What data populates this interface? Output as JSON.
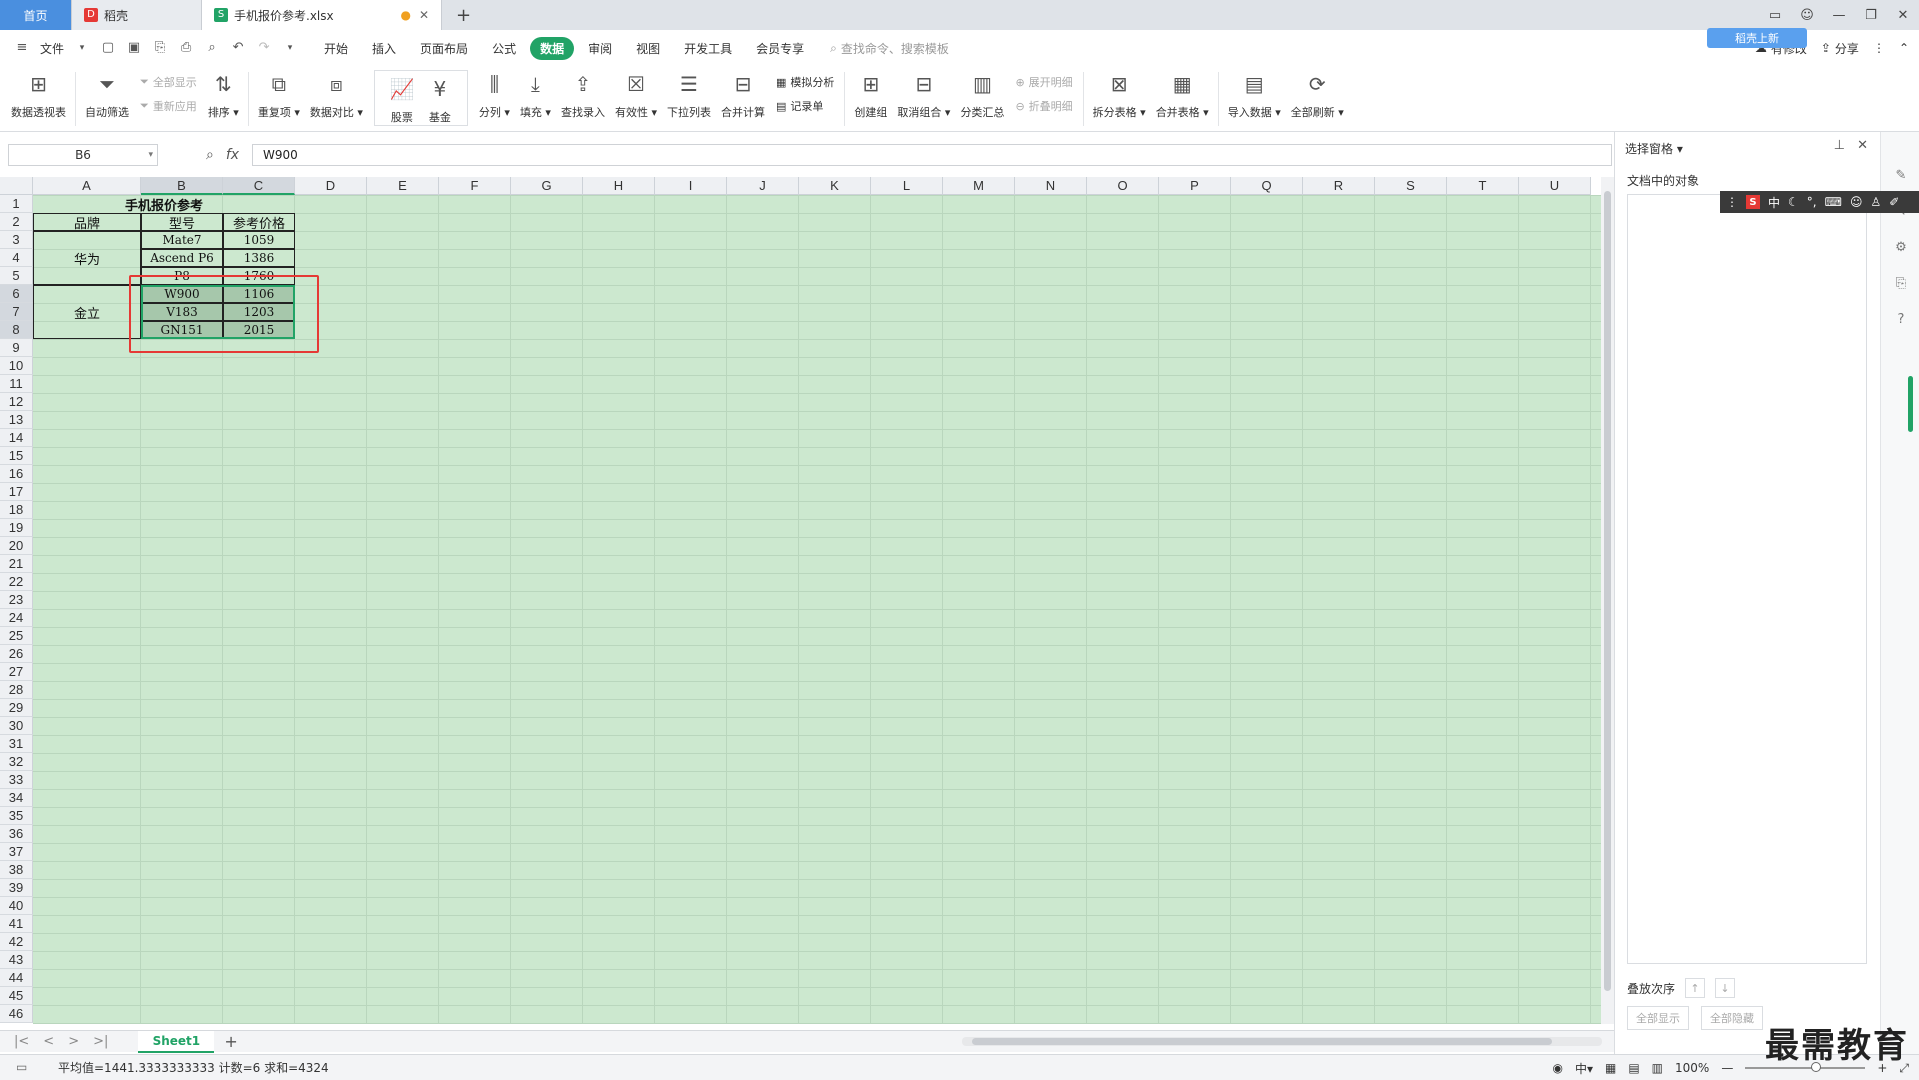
{
  "titlebar": {
    "tabs": [
      {
        "label": "首页"
      },
      {
        "label": "稻壳"
      },
      {
        "label": "手机报价参考.xlsx"
      }
    ],
    "add_tab": "+",
    "window_controls": {
      "minimize": "—",
      "restore": "❐",
      "close": "✕"
    }
  },
  "menubar": {
    "file_menu": "文件",
    "tabs": [
      "开始",
      "插入",
      "页面布局",
      "公式",
      "数据",
      "审阅",
      "视图",
      "开发工具",
      "会员专享"
    ],
    "active_tab": "数据",
    "search_placeholder": "查找命令、搜索模板",
    "right": {
      "unsynced": "有修改",
      "share": "分享"
    },
    "login_badge": "稻壳上新"
  },
  "ribbon": {
    "pivot": "数据透视表",
    "autofilter": "自动筛选",
    "show_all": "全部显示",
    "reapply": "重新应用",
    "sort": "排序",
    "duplicates": "重复项",
    "compare": "数据对比",
    "stock": "股票",
    "fund": "基金",
    "split": "分列",
    "fill": "填充",
    "lookup": "查找录入",
    "validity": "有效性",
    "dropdown": "下拉列表",
    "consolidate": "合并计算",
    "whatif": "模拟分析",
    "record": "记录单",
    "group": "创建组",
    "ungroup": "取消组合",
    "subtotal": "分类汇总",
    "expand": "展开明细",
    "collapse": "折叠明细",
    "split_table": "拆分表格",
    "merge_table": "合并表格",
    "import": "导入数据",
    "refresh_all": "全部刷新"
  },
  "formula_bar": {
    "name_box": "B6",
    "fx": "fx",
    "value": "W900"
  },
  "columns": [
    "A",
    "B",
    "C",
    "D",
    "E",
    "F",
    "G",
    "H",
    "I",
    "J",
    "K",
    "L",
    "M",
    "N",
    "O",
    "P",
    "Q",
    "R",
    "S",
    "T",
    "U"
  ],
  "rows": [
    "1",
    "2",
    "3",
    "4",
    "5",
    "6",
    "7",
    "8",
    "9",
    "10",
    "11",
    "12",
    "13",
    "14",
    "15",
    "16",
    "17",
    "18",
    "19",
    "20",
    "21",
    "22",
    "23",
    "24",
    "25",
    "26",
    "27",
    "28",
    "29",
    "30",
    "31",
    "32",
    "33",
    "34",
    "35",
    "36",
    "37",
    "38",
    "39",
    "40",
    "41",
    "42",
    "43",
    "44",
    "45",
    "46"
  ],
  "sheet": {
    "title": "手机报价参考",
    "headers": {
      "brand": "品牌",
      "model": "型号",
      "price": "参考价格"
    },
    "groups": [
      {
        "brand": "华为",
        "items": [
          {
            "model": "Mate7",
            "price": "1059"
          },
          {
            "model": "Ascend P6",
            "price": "1386"
          },
          {
            "model": "P8",
            "price": "1760"
          }
        ]
      },
      {
        "brand": "金立",
        "items": [
          {
            "model": "W900",
            "price": "1106"
          },
          {
            "model": "V183",
            "price": "1203"
          },
          {
            "model": "GN151",
            "price": "2015"
          }
        ]
      }
    ]
  },
  "sheet_tabs": {
    "active": "Sheet1",
    "add": "+"
  },
  "status": {
    "summary": "平均值=1441.3333333333  计数=6  求和=4324",
    "zoom": "100%"
  },
  "side_pane": {
    "title": "选择窗格",
    "objects_label": "文档中的对象",
    "order_label": "叠放次序",
    "show_all": "全部显示",
    "hide_all": "全部隐藏"
  },
  "ime": {
    "lang": "中"
  },
  "watermark": "最需教育"
}
